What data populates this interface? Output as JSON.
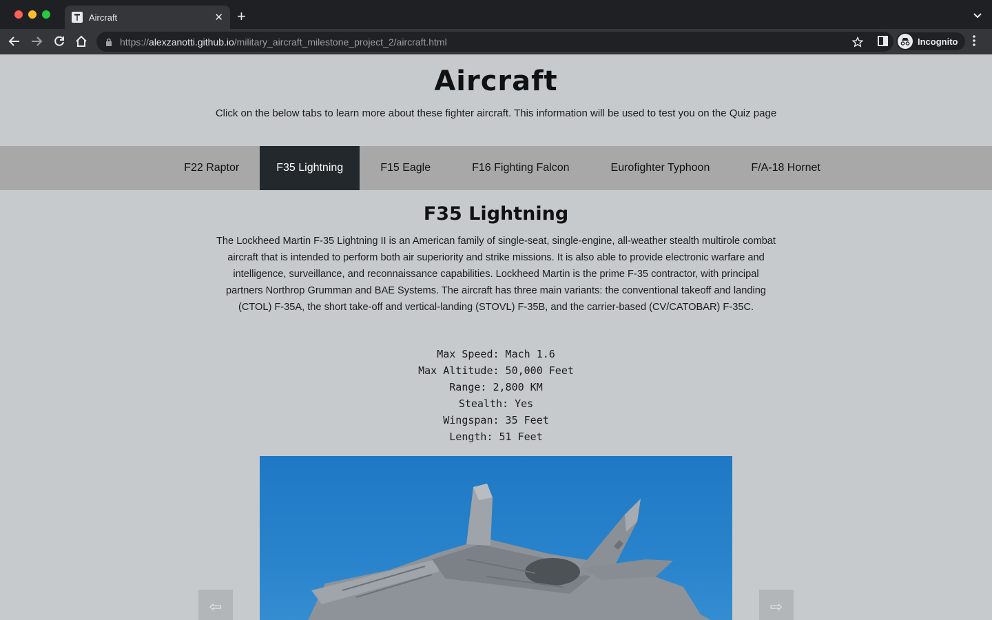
{
  "browser": {
    "tab_title": "Aircraft",
    "url_scheme": "https://",
    "url_host": "alexzanotti.github.io",
    "url_path": "/military_aircraft_milestone_project_2/aircraft.html",
    "profile_label": "Incognito"
  },
  "page": {
    "title": "Aircraft",
    "subtitle": "Click on the below tabs to learn more about these fighter aircraft. This information will be used to test you on the Quiz page"
  },
  "tabs": [
    {
      "label": "F22 Raptor",
      "active": false
    },
    {
      "label": "F35 Lightning",
      "active": true
    },
    {
      "label": "F15 Eagle",
      "active": false
    },
    {
      "label": "F16 Fighting Falcon",
      "active": false
    },
    {
      "label": "Eurofighter Typhoon",
      "active": false
    },
    {
      "label": "F/A-18 Hornet",
      "active": false
    }
  ],
  "aircraft": {
    "name": "F35 Lightning",
    "description": "The Lockheed Martin F-35 Lightning II is an American family of single-seat, single-engine, all-weather stealth multirole combat aircraft that is intended to perform both air superiority and strike missions. It is also able to provide electronic warfare and intelligence, surveillance, and reconnaissance capabilities. Lockheed Martin is the prime F-35 contractor, with principal partners Northrop Grumman and BAE Systems. The aircraft has three main variants: the conventional takeoff and landing (CTOL) F-35A, the short take-off and vertical-landing (STOVL) F-35B, and the carrier-based (CV/CATOBAR) F-35C.",
    "specs": [
      "Max Speed: Mach 1.6",
      "Max Altitude: 50,000 Feet",
      "Range: 2,800 KM",
      "Stealth: Yes",
      "Wingspan: 35 Feet",
      "Length: 51 Feet"
    ]
  },
  "carousel": {
    "prev_icon": "⇦",
    "next_icon": "⇨"
  },
  "colors": {
    "page_background": "#c6cacd",
    "tab_bar": "#a8a8a8",
    "active_tab": "#23282d",
    "sky": "#1f78c4"
  }
}
